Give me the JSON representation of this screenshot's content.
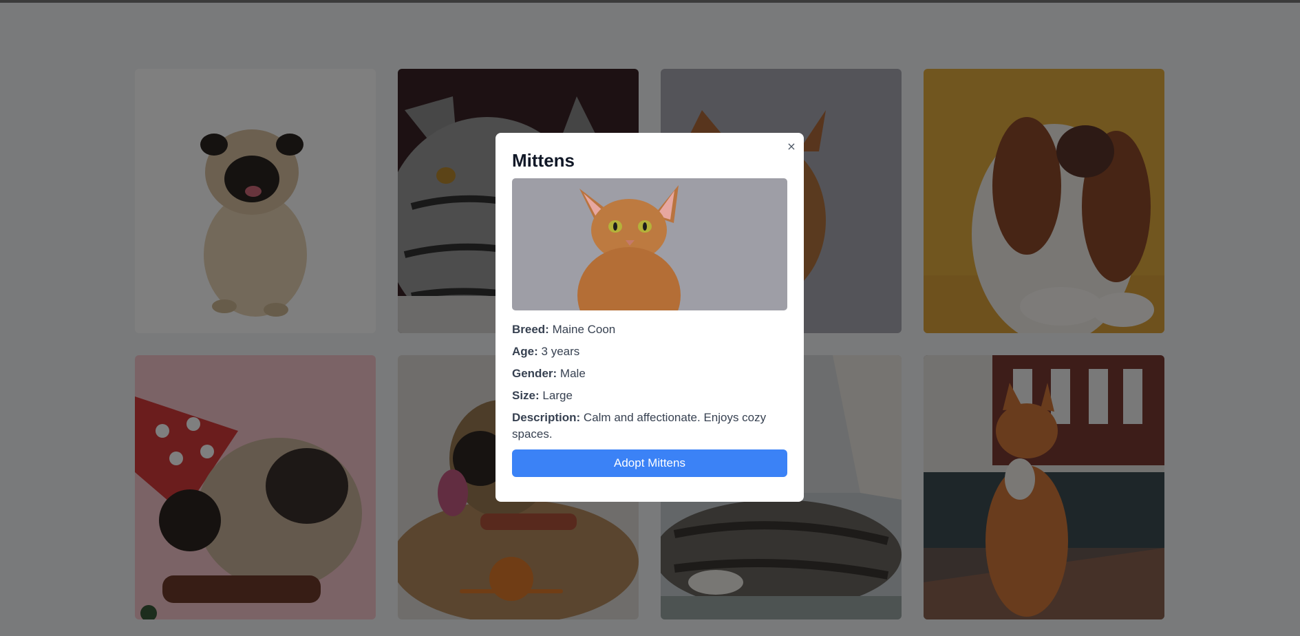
{
  "pet_grid": {
    "cards": [
      {
        "image_alt": "pug-sitting-photo"
      },
      {
        "image_alt": "silver-tabby-cat-photo"
      },
      {
        "image_alt": "abyssinian-cat-photo"
      },
      {
        "image_alt": "spaniel-dog-photo"
      },
      {
        "image_alt": "pug-party-hat-photo"
      },
      {
        "image_alt": "pug-with-ball-photo"
      },
      {
        "image_alt": "tabby-cat-lying-photo"
      },
      {
        "image_alt": "orange-cat-street-photo"
      }
    ]
  },
  "modal": {
    "title": "Mittens",
    "close_label": "×",
    "details": [
      {
        "label": "Breed:",
        "value": "Maine Coon"
      },
      {
        "label": "Age:",
        "value": "3 years"
      },
      {
        "label": "Gender:",
        "value": "Male"
      },
      {
        "label": "Size:",
        "value": "Large"
      },
      {
        "label": "Description:",
        "value": "Calm and affectionate. Enjoys cozy spaces."
      }
    ],
    "adopt_label": "Adopt Mittens"
  },
  "colors": {
    "accent": "#3b82f6",
    "overlay": "rgba(0,0,0,0.5)"
  }
}
